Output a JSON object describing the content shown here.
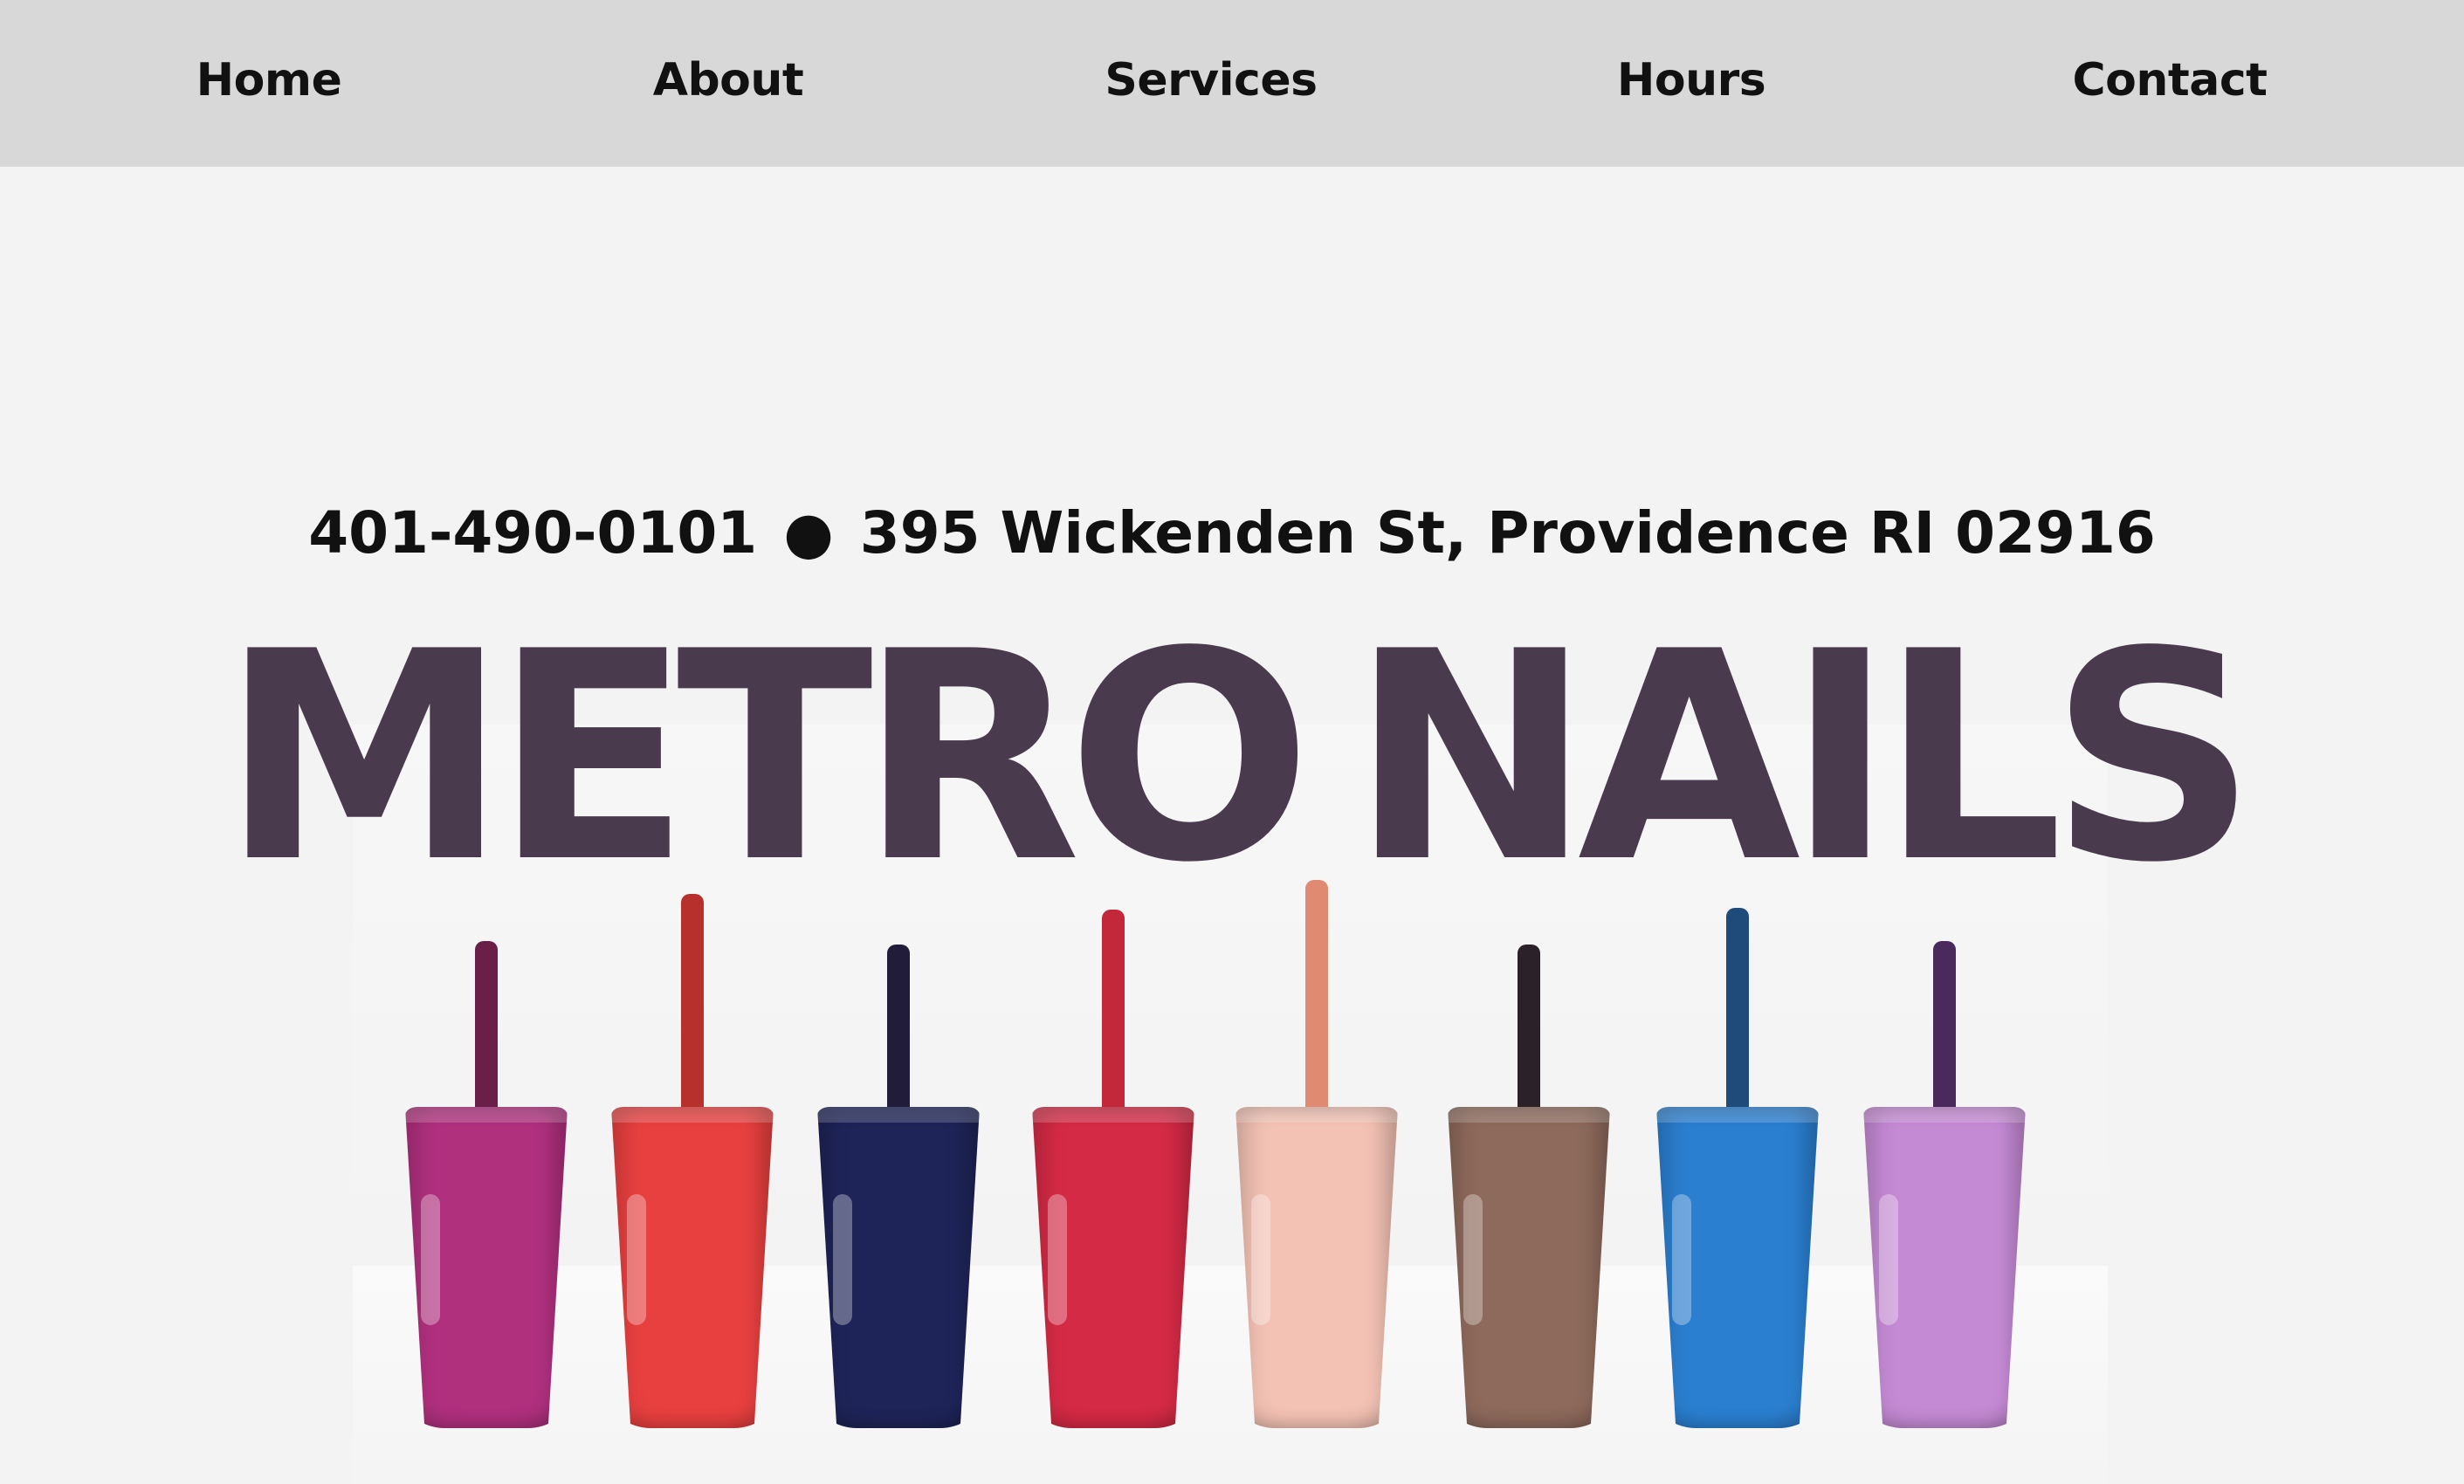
{
  "nav": {
    "items": [
      {
        "label": "Home"
      },
      {
        "label": "About"
      },
      {
        "label": "Services"
      },
      {
        "label": "Hours"
      },
      {
        "label": "Contact"
      }
    ]
  },
  "hero": {
    "phone": "401-490-0101",
    "separator": "●",
    "address": "395 Wickenden St, Providence RI 02916",
    "brand_word_1": "METRO",
    "brand_word_2": "NAILS",
    "brand_color": "#4a3a4d",
    "polish_colors": [
      "#b0307e",
      "#e8403f",
      "#1e2458",
      "#d42a45",
      "#f3c2b4",
      "#8e6a5c",
      "#2b7fd0",
      "#c58ad4"
    ]
  }
}
